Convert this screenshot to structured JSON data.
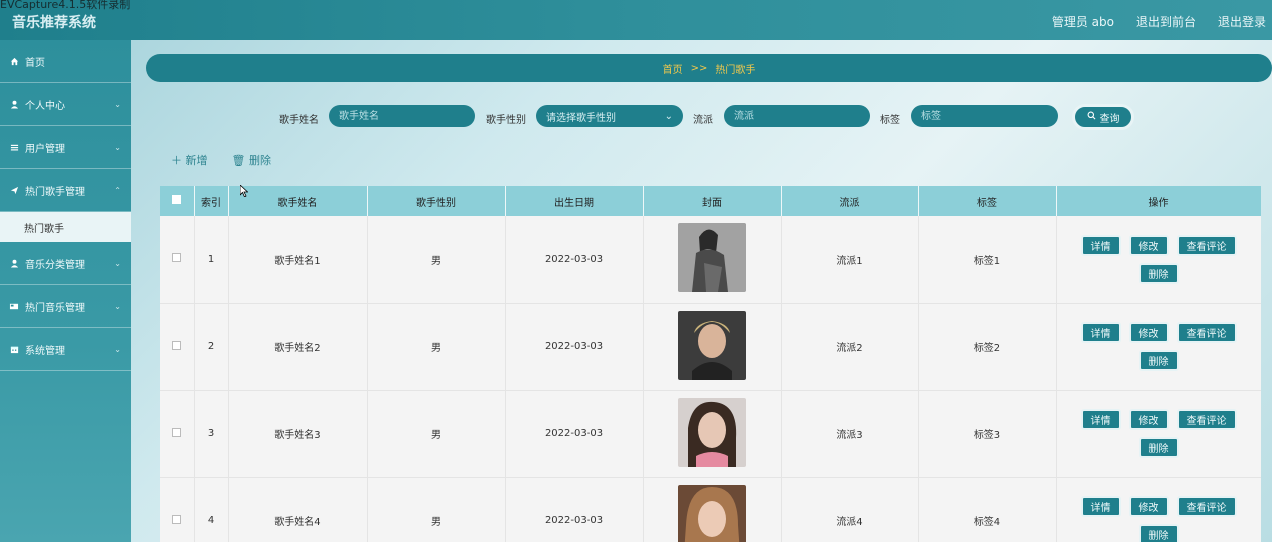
{
  "watermark": "EVCapture4.1.5软件录制",
  "header": {
    "title": "音乐推荐系统",
    "admin_label": "管理员 abo",
    "back_label": "退出到前台",
    "logout_label": "退出登录"
  },
  "sidebar": {
    "items": [
      {
        "label": "首页",
        "icon": "home-icon"
      },
      {
        "label": "个人中心",
        "icon": "user-icon"
      },
      {
        "label": "用户管理",
        "icon": "users-icon"
      },
      {
        "label": "热门歌手管理",
        "icon": "send-icon"
      },
      {
        "label": "音乐分类管理",
        "icon": "user-icon"
      },
      {
        "label": "热门音乐管理",
        "icon": "card-icon"
      },
      {
        "label": "系统管理",
        "icon": "calendar-icon"
      }
    ],
    "sub_item": "热门歌手"
  },
  "breadcrumb": {
    "home": "首页",
    "sep": ">>",
    "current": "热门歌手"
  },
  "search": {
    "name_label": "歌手姓名",
    "name_placeholder": "歌手姓名",
    "gender_label": "歌手性别",
    "gender_placeholder": "请选择歌手性别",
    "genre_label": "流派",
    "genre_placeholder": "流派",
    "tag_label": "标签",
    "tag_placeholder": "标签",
    "query_label": "查询"
  },
  "actions": {
    "add_label": "新增",
    "delete_label": "删除"
  },
  "table": {
    "headers": [
      "索引",
      "歌手姓名",
      "歌手性别",
      "出生日期",
      "封面",
      "流派",
      "标签",
      "操作"
    ],
    "rows": [
      {
        "index": "1",
        "name": "歌手姓名1",
        "gender": "男",
        "birth": "2022-03-03",
        "genre": "流派1",
        "tag": "标签1"
      },
      {
        "index": "2",
        "name": "歌手姓名2",
        "gender": "男",
        "birth": "2022-03-03",
        "genre": "流派2",
        "tag": "标签2"
      },
      {
        "index": "3",
        "name": "歌手姓名3",
        "gender": "男",
        "birth": "2022-03-03",
        "genre": "流派3",
        "tag": "标签3"
      },
      {
        "index": "4",
        "name": "歌手姓名4",
        "gender": "男",
        "birth": "2022-03-03",
        "genre": "流派4",
        "tag": "标签4"
      }
    ],
    "op_buttons": {
      "detail": "详情",
      "edit": "修改",
      "comments": "查看评论",
      "delete": "删除"
    }
  },
  "colors": {
    "accent": "#1f7f8c",
    "header_row": "#8ccfd8",
    "breadcrumb_text": "#f2c94c"
  }
}
